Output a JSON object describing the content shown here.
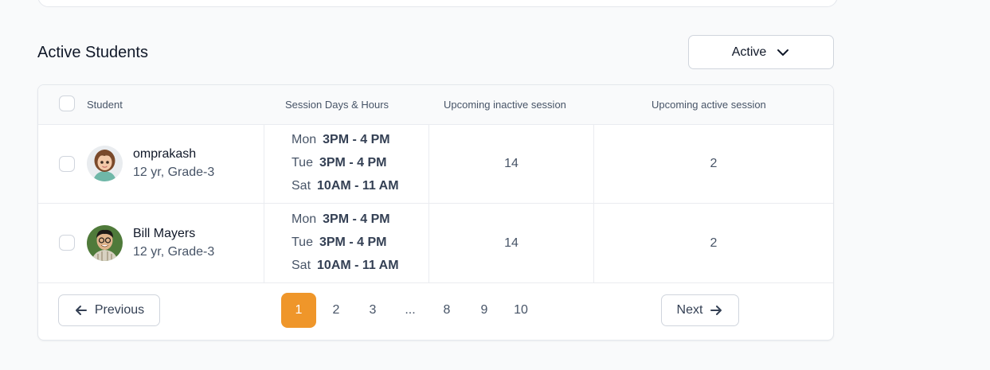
{
  "section_title": "Active Students",
  "filter": {
    "label": "Active",
    "icon": "chevron-down-icon"
  },
  "table": {
    "headers": {
      "student": "Student",
      "session": "Session Days & Hours",
      "inactive": "Upcoming inactive session",
      "active": "Upcoming active session"
    },
    "rows": [
      {
        "name": "omprakash",
        "meta": "12 yr, Grade-3",
        "sessions": [
          {
            "day": "Mon",
            "time": "3PM - 4 PM"
          },
          {
            "day": "Tue",
            "time": "3PM - 4 PM"
          },
          {
            "day": "Sat",
            "time": "10AM - 11 AM"
          }
        ],
        "inactive": "14",
        "active": "2"
      },
      {
        "name": "Bill Mayers",
        "meta": "12 yr, Grade-3",
        "sessions": [
          {
            "day": "Mon",
            "time": "3PM - 4 PM"
          },
          {
            "day": "Tue",
            "time": "3PM - 4 PM"
          },
          {
            "day": "Sat",
            "time": "10AM - 11 AM"
          }
        ],
        "inactive": "14",
        "active": "2"
      }
    ]
  },
  "pagination": {
    "previous": "Previous",
    "next": "Next",
    "pages": [
      "1",
      "2",
      "3",
      "...",
      "8",
      "9",
      "10"
    ],
    "current": "1"
  },
  "colors": {
    "accent": "#ef962a"
  }
}
